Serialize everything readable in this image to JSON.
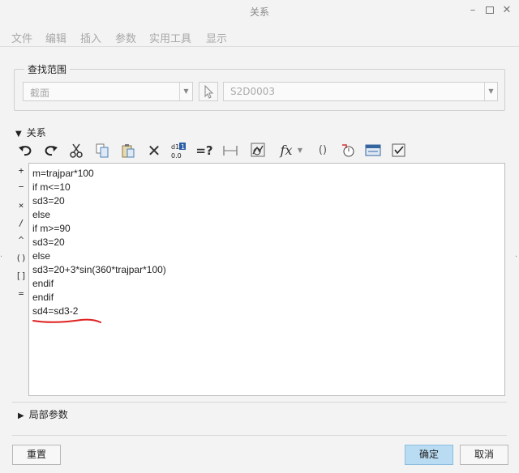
{
  "window": {
    "title": "关系"
  },
  "menu": [
    "文件",
    "编辑",
    "插入",
    "参数",
    "实用工具",
    "显示"
  ],
  "find_scope": {
    "legend": "查找范围",
    "type_value": "截面",
    "name_value": "S2D0003"
  },
  "relations": {
    "header": "关系",
    "toolbar_icons": [
      "undo-icon",
      "redo-icon",
      "cut-icon",
      "copy-icon",
      "paste-icon",
      "delete-icon",
      "switch-dims-icon",
      "evaluate-icon",
      "measure-icon",
      "analysis-icon",
      "function-icon",
      "parameter-icon",
      "sort-icon",
      "verify-icon",
      "units-icon",
      "export-icon"
    ],
    "toolbar_labels": {
      "evaluate": "=?",
      "fx": "fx",
      "param": "()"
    },
    "operators": [
      "+",
      "−",
      "×",
      "/",
      "^",
      "()",
      "[]",
      "="
    ],
    "code": [
      "m=trajpar*100",
      "if m<=10",
      "sd3=20",
      "else",
      "if m>=90",
      "sd3=20",
      "else",
      "sd3=20+3*sin(360*trajpar*100)",
      "endif",
      "endif",
      "sd4=sd3-2"
    ]
  },
  "local_params": {
    "header": "局部参数"
  },
  "buttons": {
    "reset": "重置",
    "ok": "确定",
    "cancel": "取消"
  },
  "colors": {
    "accent_ok": "#b9dcf3",
    "annotation": "#e02020"
  }
}
